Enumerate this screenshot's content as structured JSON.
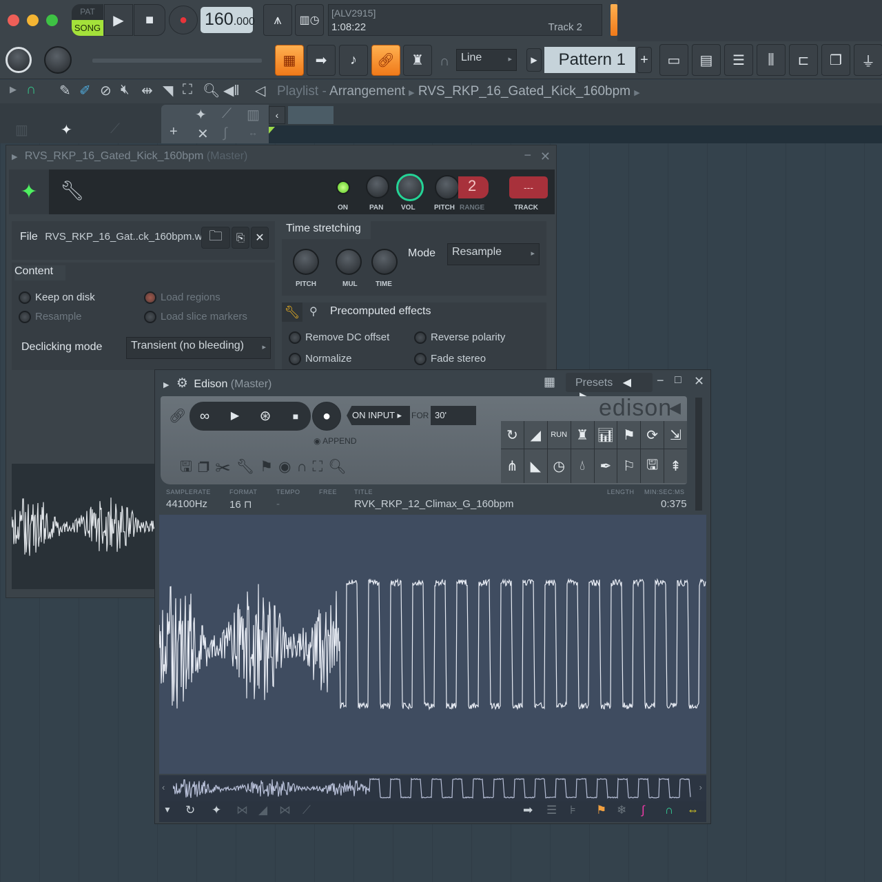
{
  "transport": {
    "pat": "PAT",
    "song": "SONG",
    "tempo": "160",
    "tempo_dec": ".000"
  },
  "hint": {
    "line1": "[ALV2915]",
    "line2": "1:08:22",
    "track": "Track 2"
  },
  "toolbar": {
    "snap": "Line",
    "pattern": "Pattern 1"
  },
  "playlist": {
    "title": "Playlist",
    "sep": " - ",
    "view": "Arrangement",
    "clip": "RVS_RKP_16_Gated_Kick_160bpm"
  },
  "channel": {
    "title": "RVS_RKP_16_Gated_Kick_160bpm",
    "title_suffix": "(Master)",
    "knobs": {
      "on": "ON",
      "pan": "PAN",
      "vol": "VOL",
      "pitch": "PITCH",
      "range": "RANGE",
      "range_value": "2",
      "track": "TRACK",
      "track_value": "---"
    },
    "file_label": "File",
    "file_name": "RVS_RKP_16_Gat..ck_160bpm.wav",
    "content_title": "Content",
    "options": [
      "Keep on disk",
      "Load regions",
      "Resample",
      "Load slice markers"
    ],
    "declick_label": "Declicking mode",
    "declick_value": "Transient (no bleeding)",
    "ts_title": "Time stretching",
    "ts_knobs": [
      "PITCH",
      "MUL",
      "TIME"
    ],
    "mode_label": "Mode",
    "mode_value": "Resample",
    "fx_title": "Precomputed effects",
    "fx": [
      "Remove DC offset",
      "Reverse polarity",
      "Normalize",
      "Fade stereo"
    ]
  },
  "edison": {
    "title": "Edison",
    "title_suffix": "(Master)",
    "presets": "Presets",
    "logo": "edison",
    "on_input": "ON INPUT",
    "for": "FOR",
    "duration": "30'",
    "append": "APPEND",
    "run": "RUN",
    "info": {
      "samplerate_label": "SAMPLERATE",
      "samplerate": "44100Hz",
      "format_label": "FORMAT",
      "format": "16",
      "tempo_label": "TEMPO",
      "tempo": "-",
      "free_label": "FREE",
      "title_label": "TITLE",
      "title": "RVK_RKP_12_Climax_G_160bpm",
      "length_label": "LENGTH",
      "unit_label": "MIN:SEC:MS",
      "length": "0:375"
    }
  },
  "colors": {
    "accent_orange": "#f7962a",
    "accent_green": "#7cf06a",
    "bg": "#34414b"
  }
}
